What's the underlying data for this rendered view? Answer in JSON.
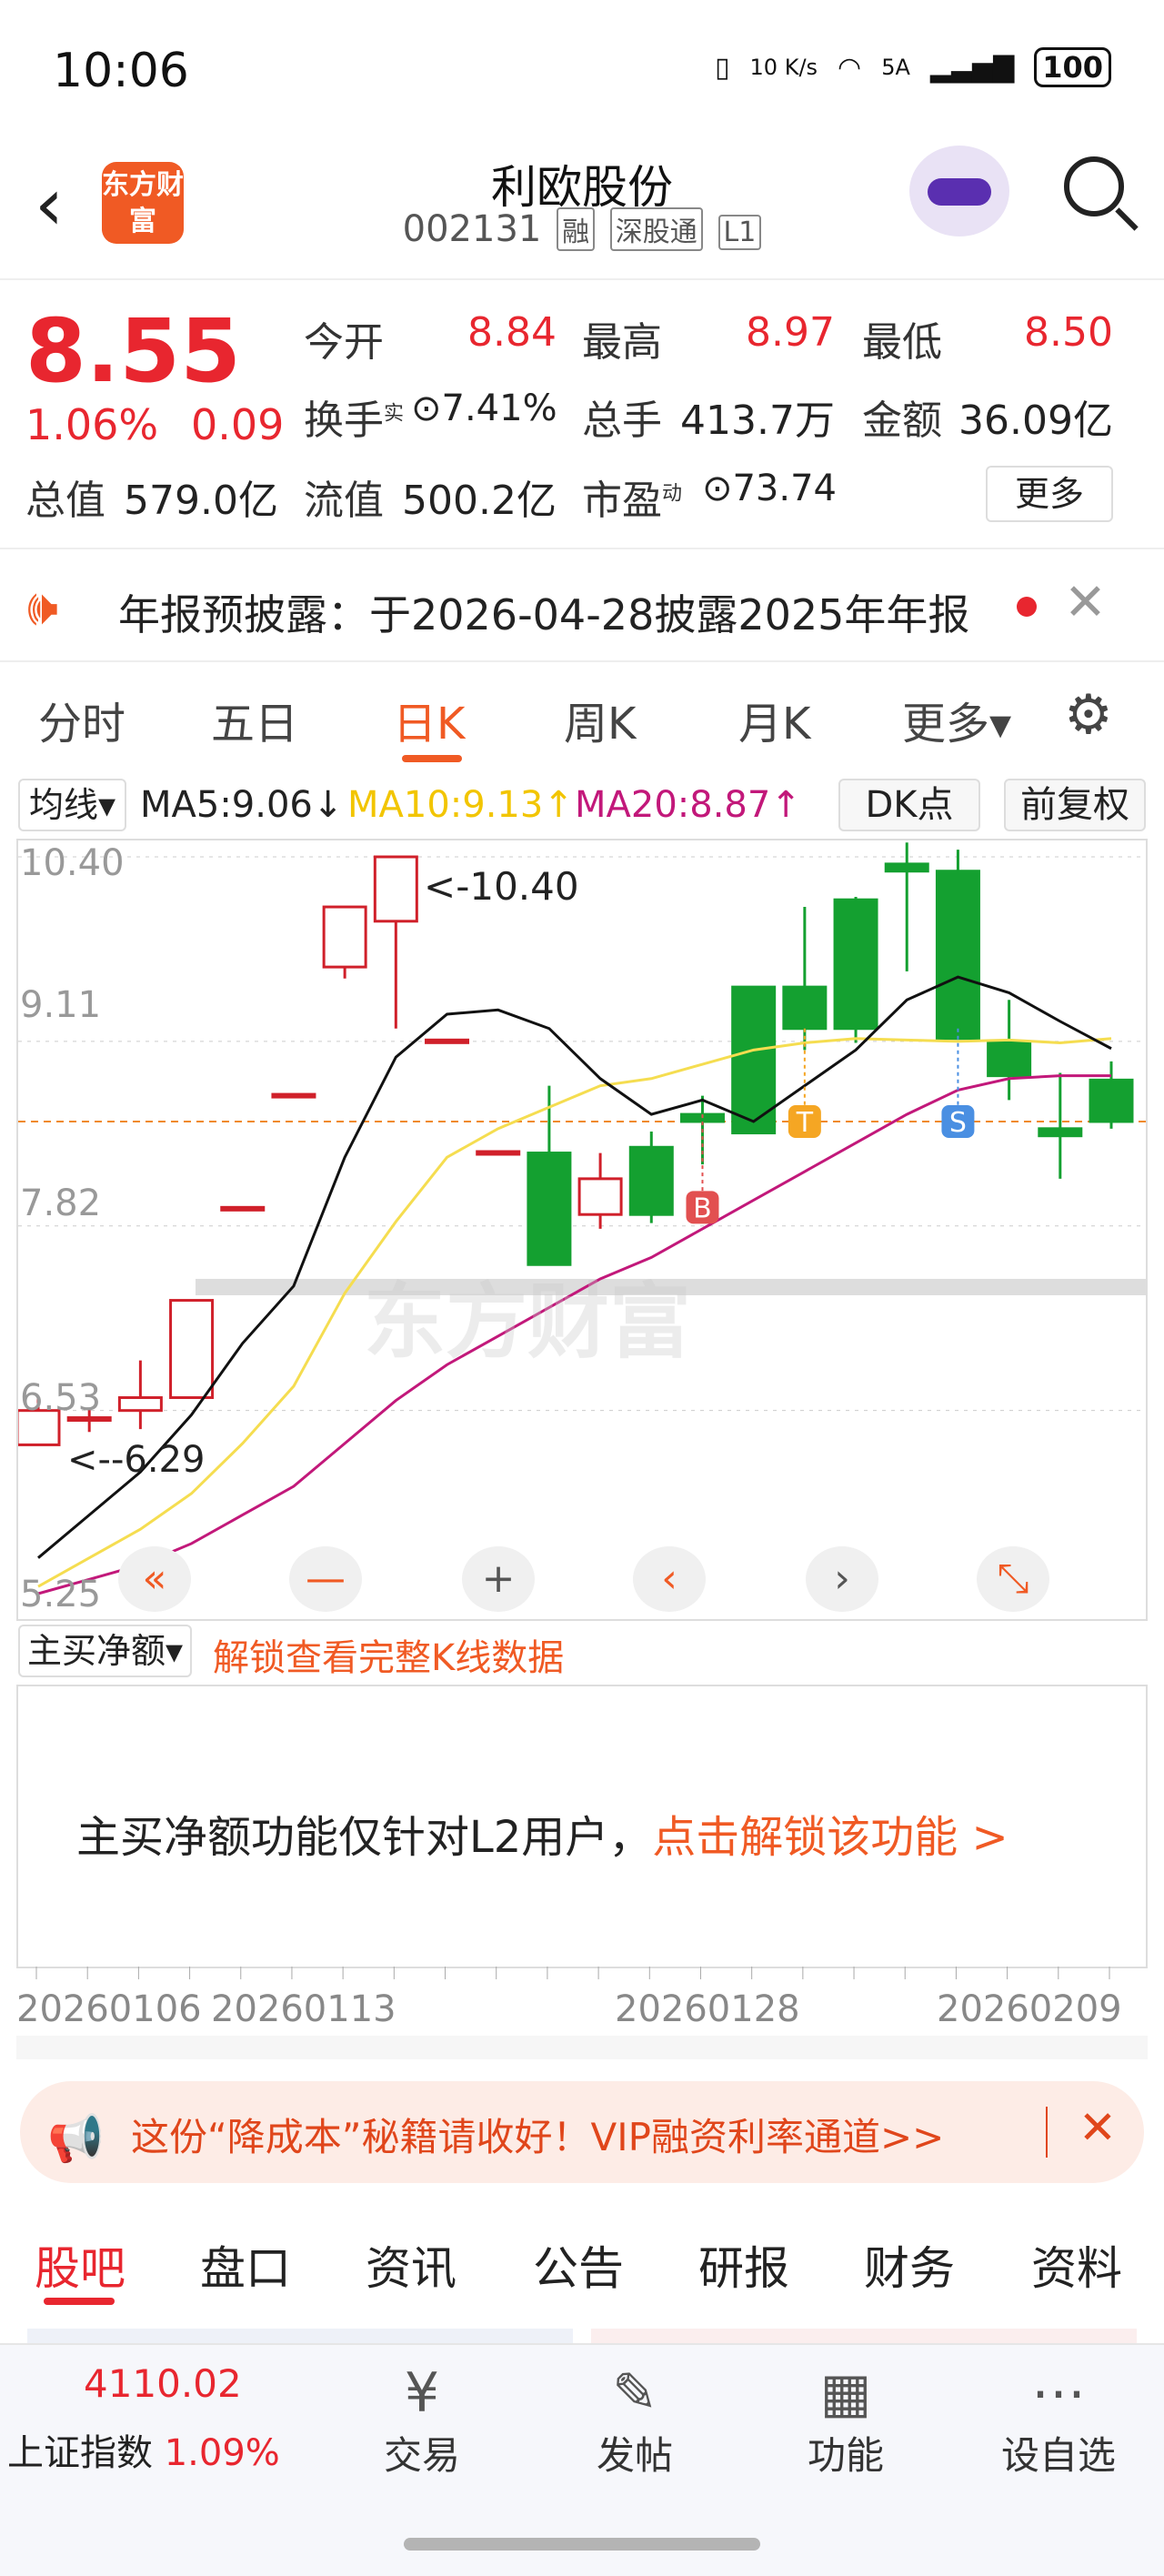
{
  "status": {
    "time": "10:06",
    "net_speed": "10 K/s",
    "signal": "5A",
    "battery": "100"
  },
  "header": {
    "title": "利欧股份",
    "code": "002131",
    "tags": [
      "融",
      "深股通",
      "L1"
    ],
    "logo_text": "东方财富"
  },
  "quote": {
    "price": "8.55",
    "change_pct": "1.06%",
    "change": "0.09",
    "open_label": "今开",
    "open": "8.84",
    "high_label": "最高",
    "high": "8.97",
    "low_label": "最低",
    "low": "8.50",
    "turnover_label": "换手",
    "turnover_sup": "实",
    "turnover": "7.41%",
    "volume_label": "总手",
    "volume": "413.7万",
    "amount_label": "金额",
    "amount": "36.09亿",
    "mktcap_label": "总值",
    "mktcap": "579.0亿",
    "float_label": "流值",
    "float": "500.2亿",
    "pe_label": "市盈",
    "pe_sup": "动",
    "pe": "73.74",
    "more": "更多"
  },
  "notice": {
    "text": "年报预披露：于2026-04-28披露2025年年报"
  },
  "tabs": [
    "分时",
    "五日",
    "日K",
    "周K",
    "月K",
    "更多▾"
  ],
  "ma": {
    "selector": "均线▾",
    "ma5": "MA5:9.06↓",
    "ma10": "MA10:9.13↑",
    "ma20": "MA20:8.87↑",
    "dk": "DK点",
    "fq": "前复权"
  },
  "chart_data": {
    "type": "candlestick",
    "y_ticks": [
      "10.40",
      "9.11",
      "7.82",
      "6.53",
      "5.25"
    ],
    "ylim": [
      5.25,
      10.4
    ],
    "annotations": [
      "<-10.40",
      "<--6.29"
    ],
    "markers": [
      "B",
      "T",
      "S"
    ],
    "watermark": "东方财富",
    "candles": [
      {
        "o": 6.29,
        "c": 6.53,
        "h": 6.62,
        "l": 6.29
      },
      {
        "o": 6.48,
        "c": 6.48,
        "h": 6.55,
        "l": 6.38
      },
      {
        "o": 6.53,
        "c": 6.62,
        "h": 6.88,
        "l": 6.4
      },
      {
        "o": 6.62,
        "c": 7.3,
        "h": 7.3,
        "l": 6.62
      },
      {
        "o": 7.95,
        "c": 7.95,
        "h": 7.95,
        "l": 7.95
      },
      {
        "o": 8.74,
        "c": 8.74,
        "h": 8.74,
        "l": 8.74
      },
      {
        "o": 9.63,
        "c": 10.05,
        "h": 10.05,
        "l": 9.55
      },
      {
        "o": 9.95,
        "c": 10.4,
        "h": 10.4,
        "l": 9.2
      },
      {
        "o": 9.12,
        "c": 9.12,
        "h": 9.12,
        "l": 9.12
      },
      {
        "o": 8.34,
        "c": 8.34,
        "h": 8.34,
        "l": 8.34
      },
      {
        "o": 8.33,
        "c": 7.55,
        "h": 8.8,
        "l": 7.55
      },
      {
        "o": 7.9,
        "c": 8.15,
        "h": 8.33,
        "l": 7.8
      },
      {
        "o": 8.37,
        "c": 7.9,
        "h": 8.48,
        "l": 7.84
      },
      {
        "o": 8.6,
        "c": 8.55,
        "h": 8.73,
        "l": 8.25
      },
      {
        "o": 9.49,
        "c": 8.47,
        "h": 9.49,
        "l": 8.47
      },
      {
        "o": 9.49,
        "c": 9.2,
        "h": 10.05,
        "l": 9.05
      },
      {
        "o": 10.1,
        "c": 9.2,
        "h": 10.12,
        "l": 9.1
      },
      {
        "o": 10.35,
        "c": 10.3,
        "h": 10.5,
        "l": 9.6
      },
      {
        "o": 10.3,
        "c": 9.13,
        "h": 10.45,
        "l": 9.13
      },
      {
        "o": 9.1,
        "c": 8.87,
        "h": 9.4,
        "l": 8.7
      },
      {
        "o": 8.5,
        "c": 8.45,
        "h": 8.89,
        "l": 8.15
      },
      {
        "o": 8.84,
        "c": 8.55,
        "h": 8.97,
        "l": 8.5
      }
    ],
    "ma5": [
      5.5,
      5.8,
      6.1,
      6.5,
      7.0,
      7.4,
      8.3,
      9.0,
      9.3,
      9.33,
      9.2,
      8.85,
      8.6,
      8.7,
      8.55,
      8.8,
      9.05,
      9.4,
      9.56,
      9.45,
      9.25,
      9.06
    ],
    "ma10": [
      5.3,
      5.5,
      5.7,
      5.95,
      6.3,
      6.7,
      7.35,
      7.85,
      8.3,
      8.5,
      8.65,
      8.8,
      8.85,
      8.95,
      9.05,
      9.1,
      9.13,
      9.12,
      9.11,
      9.12,
      9.1,
      9.13
    ],
    "ma20": [
      5.25,
      5.35,
      5.45,
      5.6,
      5.8,
      6.0,
      6.3,
      6.6,
      6.85,
      7.05,
      7.25,
      7.45,
      7.6,
      7.8,
      8.0,
      8.2,
      8.4,
      8.6,
      8.77,
      8.85,
      8.87,
      8.87
    ],
    "dashed_price": 8.55,
    "dates": [
      "20260106",
      "20260113",
      "20260128",
      "20260209"
    ]
  },
  "chart_controls": [
    "«",
    "—",
    "+",
    "‹",
    "›",
    "⤡"
  ],
  "main_buy": {
    "selector": "主买净额▾",
    "unlock_link": "解锁查看完整K线数据",
    "message": "主买净额功能仅针对L2用户，",
    "message_link": "点击解锁该功能 >"
  },
  "promo": {
    "text": "这份“降成本”秘籍请收好！VIP融资利率通道>>"
  },
  "bottom_tabs": [
    "股吧",
    "盘口",
    "资讯",
    "公告",
    "研报",
    "财务",
    "资料"
  ],
  "nav": {
    "index_value": "4110.02",
    "index_name": "上证指数",
    "index_change": "1.09%",
    "items": [
      {
        "label": "交易",
        "icon": "¥"
      },
      {
        "label": "发帖",
        "icon": "✎"
      },
      {
        "label": "功能",
        "icon": "▦"
      },
      {
        "label": "设自选",
        "icon": "⋯"
      }
    ]
  }
}
